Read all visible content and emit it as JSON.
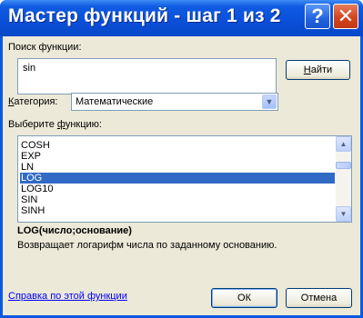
{
  "window": {
    "title": "Мастер функций - шаг 1 из 2",
    "help_glyph": "?",
    "close_glyph": "✕"
  },
  "search": {
    "label": "Поиск функции:",
    "value": "sin",
    "find_button": "Найти",
    "find_button_pre": "",
    "find_button_hotkey": "Н",
    "find_button_post": "айти"
  },
  "category": {
    "label_pre": "",
    "label_hotkey": "К",
    "label_post": "атегория:",
    "selected": "Математические"
  },
  "functions": {
    "label_pre": "Выберите ",
    "label_hotkey": "ф",
    "label_post": "ункцию:",
    "items": [
      "COSH",
      "EXP",
      "LN",
      "LOG",
      "LOG10",
      "SIN",
      "SINH"
    ],
    "selected": "LOG"
  },
  "details": {
    "signature": "LOG(число;основание)",
    "description": "Возвращает логарифм числа по заданному основанию."
  },
  "footer": {
    "help_link": "Справка по этой функции",
    "ok": "ОК",
    "cancel": "Отмена"
  },
  "colors": {
    "titlebar": "#0a4fd8",
    "dialog_bg": "#ece9d8",
    "selection": "#316ac5",
    "link": "#0000ff",
    "close_button": "#d4451f"
  }
}
